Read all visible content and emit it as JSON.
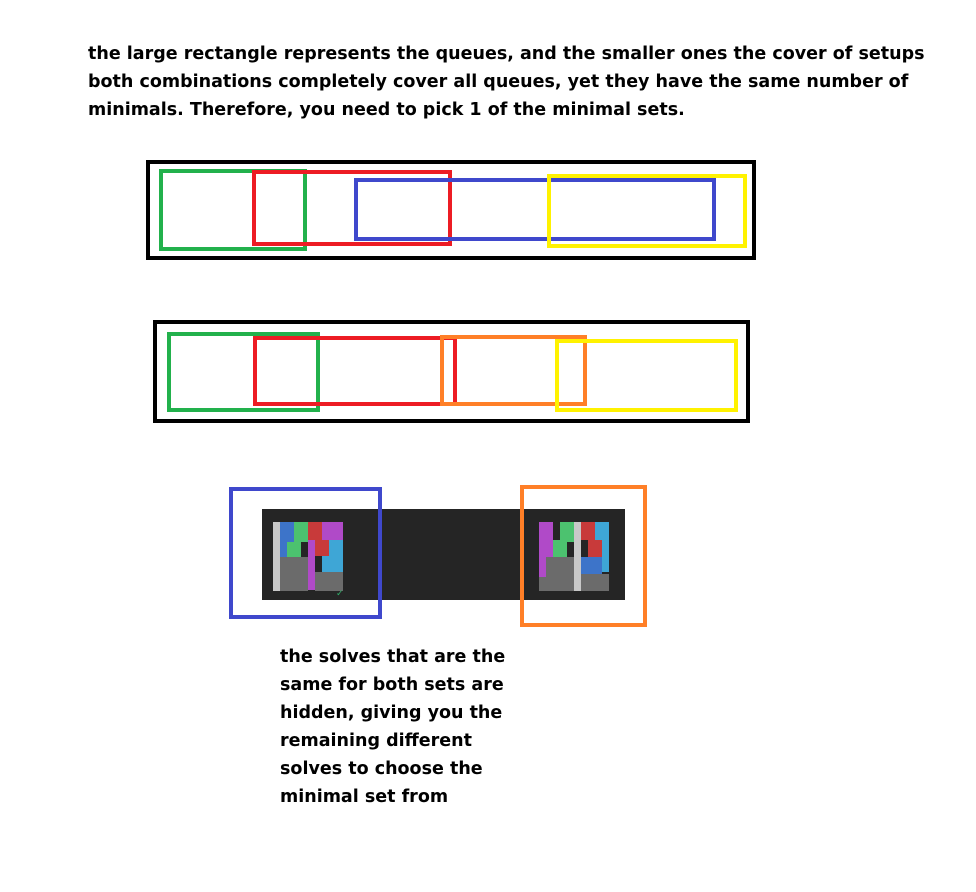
{
  "intro": {
    "line1": "the large rectangle represents the queues, and the smaller ones the cover of setups",
    "line2": "both combinations completely cover all queues, yet they have the same number of",
    "line3": "minimals. Therefore, you need to pick 1 of the minimal sets."
  },
  "note": {
    "line1": "the solves that are the",
    "line2": "same for both sets are",
    "line3": "hidden, giving you the",
    "line4": "remaining different",
    "line5": "solves to choose the",
    "line6": "minimal set from"
  },
  "colors": {
    "green": "#22b14c",
    "red": "#ed1c24",
    "blue": "#3f48cc",
    "yellow": "#fff200",
    "orange": "#ff7f27",
    "queue_border": "#000000",
    "strip": "#252525"
  },
  "combination_1": [
    "green",
    "red",
    "blue",
    "yellow"
  ],
  "combination_2": [
    "green",
    "red",
    "orange",
    "yellow"
  ],
  "solve_pair": [
    "blue",
    "orange"
  ]
}
